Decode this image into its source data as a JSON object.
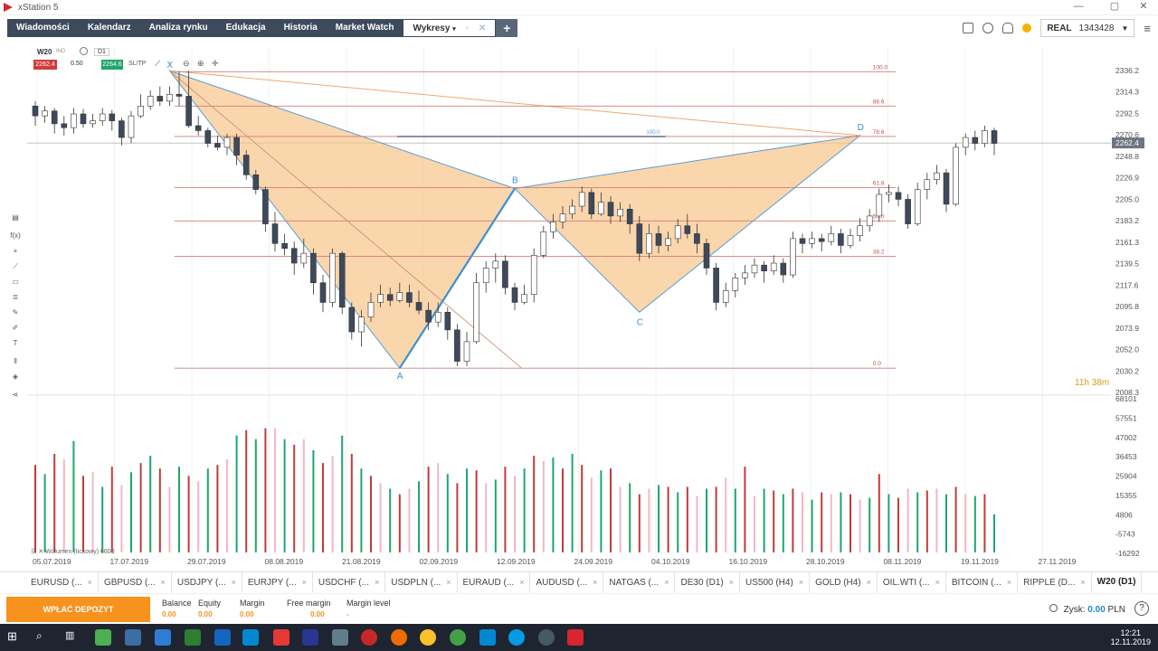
{
  "window": {
    "title": "xStation 5"
  },
  "nav": {
    "items": [
      "Wiadomości",
      "Kalendarz",
      "Analiza rynku",
      "Edukacja",
      "Historia",
      "Market Watch"
    ],
    "active": "Wykresy",
    "plus": "+"
  },
  "account": {
    "mode": "REAL",
    "number": "1343428"
  },
  "chart_header": {
    "symbol": "W20",
    "symbol_sub": "IND",
    "timeframe": "D1",
    "sell": "2262.4",
    "volume": "0.50",
    "buy": "2264.6",
    "sltp": "SL/TP"
  },
  "chart_data": {
    "type": "candlestick",
    "symbol": "W20",
    "y_ticks": [
      "2336.2",
      "2314.3",
      "2292.5",
      "2270.6",
      "2248.8",
      "2226.9",
      "2205.0",
      "2183.2",
      "2161.3",
      "2139.5",
      "2117.6",
      "2095.8",
      "2073.9",
      "2052.0",
      "2030.2",
      "2008.3"
    ],
    "ylim": [
      2008.3,
      2336.2
    ],
    "last_price": "2262.4",
    "x_ticks": [
      "05.07.2019",
      "17.07.2019",
      "29.07.2019",
      "08.08.2019",
      "21.08.2019",
      "02.09.2019",
      "12.09.2019",
      "24.09.2019",
      "04.10.2019",
      "16.10.2019",
      "28.10.2019",
      "08.11.2019",
      "19.11.2019",
      "27.11.2019"
    ],
    "fib_levels": [
      {
        "label": "100.0",
        "value": 2335
      },
      {
        "label": "88.6",
        "value": 2300
      },
      {
        "label": "78.6",
        "value": 2269
      },
      {
        "label": "61.8",
        "value": 2217
      },
      {
        "label": "50.0",
        "value": 2183
      },
      {
        "label": "38.2",
        "value": 2147
      },
      {
        "label": "0.0",
        "value": 2033
      }
    ],
    "pattern_points": [
      {
        "label": "X",
        "value": 2336
      },
      {
        "label": "A",
        "value": 2033
      },
      {
        "label": "B",
        "value": 2216
      },
      {
        "label": "C",
        "value": 2090
      },
      {
        "label": "D",
        "value": 2270
      }
    ],
    "inner_label": "100.0",
    "countdown": {
      "hours": "11",
      "h": "h",
      "minutes": "38",
      "m": "m"
    },
    "candles": [
      [
        2300,
        2290,
        2305,
        2280
      ],
      [
        2290,
        2295,
        2300,
        2283
      ],
      [
        2295,
        2282,
        2298,
        2272
      ],
      [
        2282,
        2278,
        2290,
        2270
      ],
      [
        2278,
        2292,
        2298,
        2272
      ],
      [
        2292,
        2282,
        2297,
        2278
      ],
      [
        2282,
        2285,
        2292,
        2278
      ],
      [
        2285,
        2292,
        2298,
        2280
      ],
      [
        2292,
        2285,
        2296,
        2275
      ],
      [
        2285,
        2268,
        2288,
        2260
      ],
      [
        2268,
        2290,
        2295,
        2262
      ],
      [
        2290,
        2300,
        2312,
        2288
      ],
      [
        2300,
        2310,
        2316,
        2296
      ],
      [
        2310,
        2305,
        2320,
        2300
      ],
      [
        2305,
        2312,
        2320,
        2300
      ],
      [
        2312,
        2310,
        2335,
        2300
      ],
      [
        2310,
        2280,
        2336,
        2278
      ],
      [
        2280,
        2275,
        2290,
        2270
      ],
      [
        2275,
        2262,
        2278,
        2258
      ],
      [
        2262,
        2258,
        2270,
        2255
      ],
      [
        2258,
        2268,
        2272,
        2250
      ],
      [
        2268,
        2250,
        2272,
        2240
      ],
      [
        2250,
        2230,
        2255,
        2225
      ],
      [
        2230,
        2215,
        2235,
        2210
      ],
      [
        2215,
        2180,
        2218,
        2172
      ],
      [
        2180,
        2160,
        2192,
        2152
      ],
      [
        2160,
        2155,
        2170,
        2148
      ],
      [
        2155,
        2140,
        2162,
        2128
      ],
      [
        2140,
        2150,
        2165,
        2135
      ],
      [
        2150,
        2120,
        2155,
        2108
      ],
      [
        2120,
        2100,
        2128,
        2090
      ],
      [
        2100,
        2150,
        2155,
        2095
      ],
      [
        2150,
        2095,
        2152,
        2088
      ],
      [
        2095,
        2070,
        2100,
        2062
      ],
      [
        2070,
        2085,
        2092,
        2055
      ],
      [
        2085,
        2100,
        2110,
        2080
      ],
      [
        2100,
        2108,
        2118,
        2095
      ],
      [
        2108,
        2102,
        2115,
        2096
      ],
      [
        2102,
        2110,
        2120,
        2100
      ],
      [
        2110,
        2100,
        2118,
        2095
      ],
      [
        2100,
        2092,
        2112,
        2088
      ],
      [
        2092,
        2080,
        2100,
        2072
      ],
      [
        2080,
        2090,
        2100,
        2075
      ],
      [
        2090,
        2072,
        2095,
        2062
      ],
      [
        2072,
        2040,
        2078,
        2035
      ],
      [
        2040,
        2060,
        2070,
        2035
      ],
      [
        2060,
        2120,
        2130,
        2058
      ],
      [
        2120,
        2135,
        2142,
        2110
      ],
      [
        2135,
        2142,
        2150,
        2120
      ],
      [
        2142,
        2115,
        2148,
        2108
      ],
      [
        2115,
        2100,
        2120,
        2092
      ],
      [
        2100,
        2108,
        2118,
        2098
      ],
      [
        2108,
        2148,
        2155,
        2100
      ],
      [
        2148,
        2172,
        2178,
        2145
      ],
      [
        2172,
        2182,
        2190,
        2165
      ],
      [
        2182,
        2190,
        2198,
        2175
      ],
      [
        2190,
        2198,
        2205,
        2185
      ],
      [
        2198,
        2212,
        2218,
        2192
      ],
      [
        2212,
        2190,
        2216,
        2185
      ],
      [
        2190,
        2202,
        2212,
        2188
      ],
      [
        2202,
        2188,
        2208,
        2180
      ],
      [
        2188,
        2195,
        2202,
        2182
      ],
      [
        2195,
        2180,
        2200,
        2170
      ],
      [
        2180,
        2150,
        2188,
        2142
      ],
      [
        2150,
        2170,
        2180,
        2145
      ],
      [
        2170,
        2158,
        2178,
        2150
      ],
      [
        2158,
        2165,
        2172,
        2152
      ],
      [
        2165,
        2178,
        2185,
        2160
      ],
      [
        2178,
        2170,
        2190,
        2165
      ],
      [
        2170,
        2160,
        2180,
        2150
      ],
      [
        2160,
        2135,
        2165,
        2128
      ],
      [
        2135,
        2100,
        2140,
        2092
      ],
      [
        2100,
        2112,
        2120,
        2095
      ],
      [
        2112,
        2125,
        2130,
        2105
      ],
      [
        2125,
        2130,
        2138,
        2118
      ],
      [
        2130,
        2138,
        2145,
        2125
      ],
      [
        2138,
        2132,
        2142,
        2120
      ],
      [
        2132,
        2140,
        2148,
        2128
      ],
      [
        2140,
        2128,
        2145,
        2120
      ],
      [
        2128,
        2165,
        2172,
        2125
      ],
      [
        2165,
        2160,
        2170,
        2150
      ],
      [
        2160,
        2165,
        2172,
        2155
      ],
      [
        2165,
        2162,
        2170,
        2152
      ],
      [
        2162,
        2170,
        2178,
        2158
      ],
      [
        2170,
        2158,
        2175,
        2150
      ],
      [
        2158,
        2168,
        2175,
        2155
      ],
      [
        2168,
        2178,
        2186,
        2162
      ],
      [
        2178,
        2188,
        2195,
        2172
      ],
      [
        2188,
        2210,
        2216,
        2182
      ],
      [
        2210,
        2212,
        2220,
        2202
      ],
      [
        2212,
        2205,
        2218,
        2198
      ],
      [
        2205,
        2180,
        2210,
        2175
      ],
      [
        2180,
        2215,
        2222,
        2178
      ],
      [
        2215,
        2225,
        2232,
        2205
      ],
      [
        2225,
        2232,
        2240,
        2220
      ],
      [
        2232,
        2200,
        2236,
        2192
      ],
      [
        2200,
        2258,
        2262,
        2198
      ],
      [
        2258,
        2268,
        2272,
        2250
      ],
      [
        2268,
        2262,
        2275,
        2255
      ],
      [
        2262,
        2275,
        2280,
        2258
      ],
      [
        2275,
        2262,
        2278,
        2250
      ]
    ],
    "volumes": [
      [
        -1,
        32000
      ],
      [
        1,
        27000
      ],
      [
        -1,
        38000
      ],
      [
        1,
        35000
      ],
      [
        -1,
        45000
      ],
      [
        -1,
        26000
      ],
      [
        -1,
        28000
      ],
      [
        1,
        20000
      ],
      [
        1,
        31000
      ],
      [
        1,
        21000
      ],
      [
        1,
        28000
      ],
      [
        -1,
        33000
      ],
      [
        1,
        37000
      ],
      [
        1,
        30000
      ],
      [
        -1,
        20000
      ],
      [
        1,
        31000
      ],
      [
        1,
        26000
      ],
      [
        -1,
        23000
      ],
      [
        1,
        30000
      ],
      [
        1,
        32000
      ],
      [
        -1,
        35000
      ],
      [
        -1,
        48000
      ],
      [
        -1,
        51000
      ],
      [
        -1,
        46000
      ],
      [
        -1,
        52000
      ],
      [
        -1,
        52000
      ],
      [
        1,
        46000
      ],
      [
        1,
        43000
      ],
      [
        1,
        46000
      ],
      [
        1,
        40000
      ],
      [
        1,
        33000
      ],
      [
        1,
        37000
      ],
      [
        1,
        48000
      ],
      [
        1,
        38000
      ],
      [
        1,
        30000
      ],
      [
        1,
        26000
      ],
      [
        1,
        22000
      ],
      [
        1,
        19000
      ],
      [
        1,
        16000
      ],
      [
        1,
        19000
      ],
      [
        1,
        23000
      ],
      [
        1,
        31000
      ],
      [
        1,
        33000
      ],
      [
        1,
        27000
      ],
      [
        1,
        22000
      ],
      [
        1,
        30000
      ],
      [
        1,
        29000
      ],
      [
        1,
        22000
      ],
      [
        1,
        24000
      ],
      [
        1,
        31000
      ],
      [
        1,
        26000
      ],
      [
        1,
        30000
      ],
      [
        1,
        37000
      ],
      [
        1,
        34000
      ],
      [
        1,
        36000
      ],
      [
        1,
        30000
      ],
      [
        1,
        38000
      ],
      [
        1,
        32000
      ],
      [
        1,
        25000
      ],
      [
        1,
        29000
      ],
      [
        1,
        30000
      ],
      [
        1,
        20000
      ],
      [
        1,
        22000
      ],
      [
        1,
        16000
      ],
      [
        1,
        19000
      ],
      [
        1,
        21000
      ],
      [
        1,
        20000
      ],
      [
        1,
        17000
      ],
      [
        1,
        20000
      ],
      [
        1,
        15000
      ],
      [
        1,
        19000
      ],
      [
        1,
        20000
      ],
      [
        1,
        25000
      ],
      [
        1,
        19000
      ],
      [
        1,
        31000
      ],
      [
        1,
        15000
      ],
      [
        1,
        19000
      ],
      [
        1,
        18000
      ],
      [
        1,
        16000
      ],
      [
        1,
        19000
      ],
      [
        1,
        17000
      ],
      [
        1,
        13000
      ],
      [
        1,
        17000
      ],
      [
        1,
        16000
      ],
      [
        1,
        17000
      ],
      [
        1,
        16000
      ],
      [
        1,
        13000
      ],
      [
        1,
        14000
      ],
      [
        1,
        27000
      ],
      [
        1,
        16000
      ],
      [
        1,
        14000
      ],
      [
        1,
        19000
      ],
      [
        1,
        17000
      ],
      [
        1,
        18000
      ],
      [
        1,
        19000
      ],
      [
        1,
        16000
      ],
      [
        1,
        20000
      ],
      [
        1,
        16000
      ],
      [
        1,
        15000
      ],
      [
        1,
        16000
      ],
      [
        1,
        5000
      ]
    ],
    "volume_ticks": [
      "68101",
      "57551",
      "47002",
      "36453",
      "25904",
      "15355",
      "4806",
      "-5743",
      "-16292"
    ],
    "volume_label": "Wolumen (tickowy) 6600"
  },
  "tabs": [
    {
      "label": "EURUSD (...",
      "active": false
    },
    {
      "label": "GBPUSD (...",
      "active": false
    },
    {
      "label": "USDJPY (...",
      "active": false
    },
    {
      "label": "EURJPY (...",
      "active": false
    },
    {
      "label": "USDCHF (...",
      "active": false
    },
    {
      "label": "USDPLN (...",
      "active": false
    },
    {
      "label": "EURAUD (...",
      "active": false
    },
    {
      "label": "AUDUSD (...",
      "active": false
    },
    {
      "label": "NATGAS (...",
      "active": false
    },
    {
      "label": "DE30 (D1)",
      "active": false
    },
    {
      "label": "US500 (H4)",
      "active": false
    },
    {
      "label": "GOLD (H4)",
      "active": false
    },
    {
      "label": "OIL.WTI (...",
      "active": false
    },
    {
      "label": "BITCOIN (...",
      "active": false
    },
    {
      "label": "RIPPLE (D...",
      "active": false
    },
    {
      "label": "W20 (D1)",
      "active": true
    }
  ],
  "tab_close": "×",
  "account_bar": {
    "deposit": "WPŁAĆ DEPOZYT",
    "fields": [
      {
        "label": "Balance",
        "value": "0.00"
      },
      {
        "label": "Equity",
        "value": "0.00"
      },
      {
        "label": "Margin",
        "value": "0.00"
      },
      {
        "label": "Free margin",
        "value": "0.00"
      },
      {
        "label": "Margin level",
        "value": "-"
      }
    ],
    "profit_label": "Zysk:",
    "profit_value": "0.00",
    "profit_currency": "PLN",
    "help": "?"
  },
  "taskbar": {
    "time": "12:21",
    "date": "12.11.2019"
  }
}
